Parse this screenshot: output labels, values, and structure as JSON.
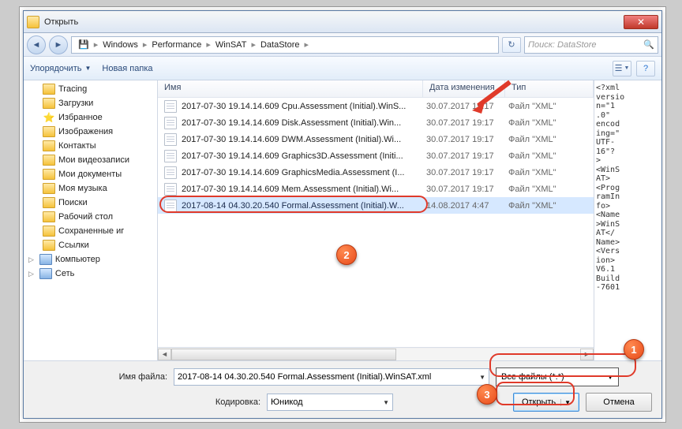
{
  "title": "Открыть",
  "breadcrumb": {
    "c1": "Windows",
    "c2": "Performance",
    "c3": "WinSAT",
    "c4": "DataStore"
  },
  "search_placeholder": "Поиск: DataStore",
  "toolbar": {
    "organize": "Упорядочить",
    "newfolder": "Новая папка"
  },
  "tree": {
    "n0": "Tracing",
    "n1": "Загрузки",
    "n2": "Избранное",
    "n3": "Изображения",
    "n4": "Контакты",
    "n5": "Мои видеозаписи",
    "n6": "Мои документы",
    "n7": "Моя музыка",
    "n8": "Поиски",
    "n9": "Рабочий стол",
    "n10": "Сохраненные иг",
    "n11": "Ссылки",
    "n12": "Компьютер",
    "n13": "Сеть"
  },
  "cols": {
    "name": "Имя",
    "date": "Дата изменения",
    "type": "Тип"
  },
  "rows": {
    "r0": {
      "name": "2017-07-30 19.14.14.609 Cpu.Assessment (Initial).WinS...",
      "date": "30.07.2017 19:17",
      "type": "Файл \"XML\""
    },
    "r1": {
      "name": "2017-07-30 19.14.14.609 Disk.Assessment (Initial).Win...",
      "date": "30.07.2017 19:17",
      "type": "Файл \"XML\""
    },
    "r2": {
      "name": "2017-07-30 19.14.14.609 DWM.Assessment (Initial).Wi...",
      "date": "30.07.2017 19:17",
      "type": "Файл \"XML\""
    },
    "r3": {
      "name": "2017-07-30 19.14.14.609 Graphics3D.Assessment (Initi...",
      "date": "30.07.2017 19:17",
      "type": "Файл \"XML\""
    },
    "r4": {
      "name": "2017-07-30 19.14.14.609 GraphicsMedia.Assessment (I...",
      "date": "30.07.2017 19:17",
      "type": "Файл \"XML\""
    },
    "r5": {
      "name": "2017-07-30 19.14.14.609 Mem.Assessment (Initial).Wi...",
      "date": "30.07.2017 19:17",
      "type": "Файл \"XML\""
    },
    "r6": {
      "name": "2017-08-14 04.30.20.540 Formal.Assessment (Initial).W...",
      "date": "14.08.2017 4:47",
      "type": "Файл \"XML\""
    }
  },
  "preview_text": "<?xml \nversio\nn=\"1\n.0\" \nencod\ning=\"\nUTF-\n16\"?\n>\n<WinS\nAT>\n<Prog\nramIn\nfo>\n<Name\n>WinS\nAT</\nName>\n<Vers\nion>\nV6.1 \nBuild\n-7601",
  "bottom": {
    "filename_label": "Имя файла:",
    "filename_value": "2017-08-14 04.30.20.540 Formal.Assessment (Initial).WinSAT.xml",
    "filter_value": "Все файлы (*.*)",
    "encoding_label": "Кодировка:",
    "encoding_value": "Юникод",
    "open": "Открыть",
    "cancel": "Отмена"
  },
  "callouts": {
    "c1": "1",
    "c2": "2",
    "c3": "3"
  }
}
